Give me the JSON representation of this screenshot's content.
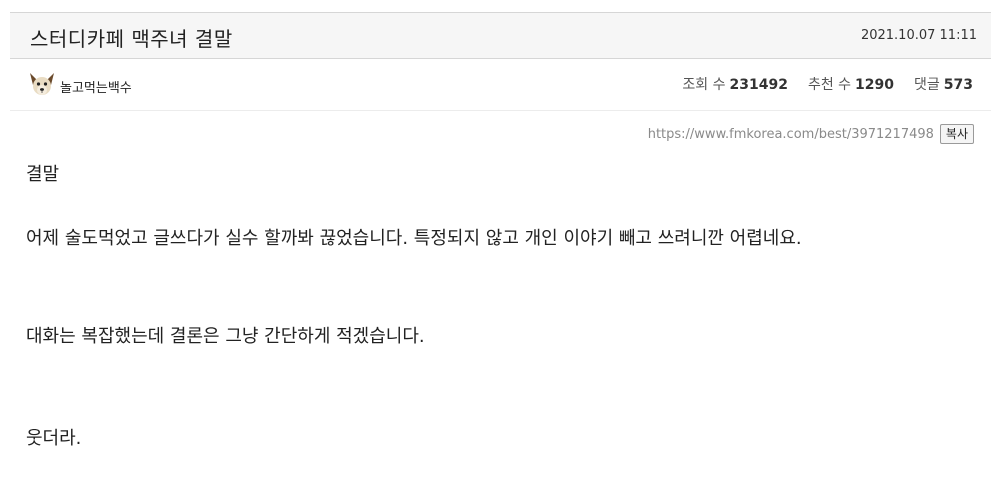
{
  "post": {
    "title": "스터디카페 맥주녀 결말",
    "date": "2021.10.07 11:11"
  },
  "author": {
    "name": "놀고먹는백수",
    "avatar_icon": "dog-avatar-icon"
  },
  "stats": {
    "views_label": "조회 수",
    "views_value": "231492",
    "recommend_label": "추천 수",
    "recommend_value": "1290",
    "comments_label": "댓글",
    "comments_value": "573"
  },
  "link": {
    "url": "https://www.fmkorea.com/best/3971217498",
    "copy_label": "복사"
  },
  "body": {
    "paragraphs": [
      "결말",
      "어제 술도먹었고 글쓰다가 실수 할까봐 끊었습니다. 특정되지 않고 개인 이야기 빼고 쓰려니깐 어렵네요.",
      "대화는 복잡했는데 결론은 그냥 간단하게 적겠습니다.",
      "웃더라."
    ]
  },
  "colors": {
    "title_bar_bg": "#f6f6f6",
    "border": "#d6d6d6",
    "url_text": "#8a8a8a"
  }
}
